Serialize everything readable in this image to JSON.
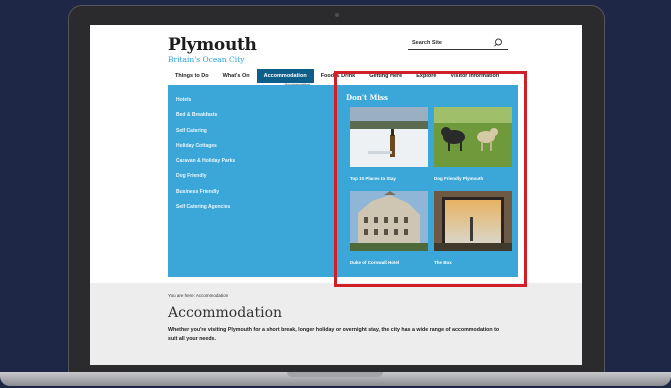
{
  "site": {
    "title": "Plymouth",
    "tagline": "Britain's Ocean City"
  },
  "search": {
    "label": "Search Site"
  },
  "nav": {
    "items": [
      {
        "label": "Things to Do",
        "active": false
      },
      {
        "label": "What's On",
        "active": false
      },
      {
        "label": "Accommodation",
        "active": true
      },
      {
        "label": "Food & Drink",
        "active": false
      },
      {
        "label": "Getting Here",
        "active": false
      },
      {
        "label": "Explore",
        "active": false
      },
      {
        "label": "Visitor Information",
        "active": false
      }
    ],
    "tooltip": "Accommodation"
  },
  "mega_menu": {
    "links": [
      "Hotels",
      "Bed & Breakfasts",
      "Self Catering",
      "Holiday Cottages",
      "Caravan & Holiday Parks",
      "Dog Friendly",
      "Business Friendly",
      "Self Catering Agencies"
    ],
    "dont_miss_heading": "Don't Miss",
    "tiles": [
      {
        "caption": "Top 10 Places to Stay",
        "image": "snowy-lawn-bottle"
      },
      {
        "caption": "Dog Friendly Plymouth",
        "image": "dogs-on-grass"
      },
      {
        "caption": "Duke of Cornwall Hotel",
        "image": "victorian-hotel"
      },
      {
        "caption": "The Box",
        "image": "window-sunset"
      }
    ]
  },
  "breadcrumb": "You are here: Accommodation",
  "page": {
    "title": "Accommodation",
    "intro": "Whether you're visiting Plymouth for a short break, longer holiday or overnight stay, the city has a wide range of accommodation to suit all your needs."
  },
  "colors": {
    "background": "#1e2745",
    "menu_blue": "#3ba7d9",
    "nav_active": "#0d5f8a",
    "tagline": "#2a9fd6",
    "highlight": "#d01f26"
  }
}
